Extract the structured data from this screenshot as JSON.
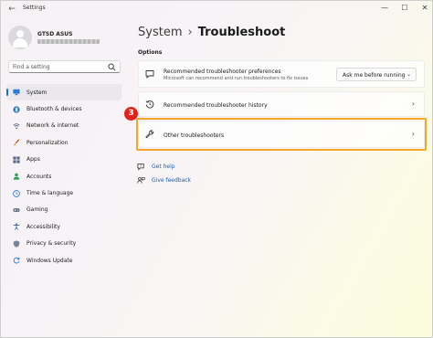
{
  "window": {
    "title": "Settings"
  },
  "user": {
    "name": "GTSD ASUS"
  },
  "search": {
    "placeholder": "Find a setting"
  },
  "nav": {
    "items": [
      {
        "label": "System",
        "icon": "monitor-icon",
        "active": true
      },
      {
        "label": "Bluetooth & devices",
        "icon": "bluetooth-icon"
      },
      {
        "label": "Network & internet",
        "icon": "network-icon"
      },
      {
        "label": "Personalization",
        "icon": "brush-icon"
      },
      {
        "label": "Apps",
        "icon": "apps-icon"
      },
      {
        "label": "Accounts",
        "icon": "person-icon"
      },
      {
        "label": "Time & language",
        "icon": "globe-clock-icon"
      },
      {
        "label": "Gaming",
        "icon": "gamepad-icon"
      },
      {
        "label": "Accessibility",
        "icon": "accessibility-icon"
      },
      {
        "label": "Privacy & security",
        "icon": "shield-icon"
      },
      {
        "label": "Windows Update",
        "icon": "update-icon"
      }
    ]
  },
  "breadcrumb": {
    "root": "System",
    "separator": "›",
    "page": "Troubleshoot"
  },
  "section": {
    "title": "Options"
  },
  "cards": {
    "preferences": {
      "title": "Recommended troubleshooter preferences",
      "subtitle": "Microsoft can recommend and run troubleshooters to fix issues",
      "dropdown_value": "Ask me before running",
      "dropdown_caret": "⌄"
    },
    "history": {
      "title": "Recommended troubleshooter history",
      "chevron": "›"
    },
    "other": {
      "title": "Other troubleshooters",
      "chevron": "›"
    }
  },
  "annotation": {
    "step": "3",
    "color": "#f4a62a",
    "badge_color": "#e2231a"
  },
  "links": {
    "get_help": "Get help",
    "give_feedback": "Give feedback"
  },
  "window_controls": {
    "back": "←",
    "minimize": "—",
    "maximize": "☐",
    "close": "✕"
  },
  "colors": {
    "accent": "#1f6fc5",
    "link": "#1a5fb4"
  }
}
